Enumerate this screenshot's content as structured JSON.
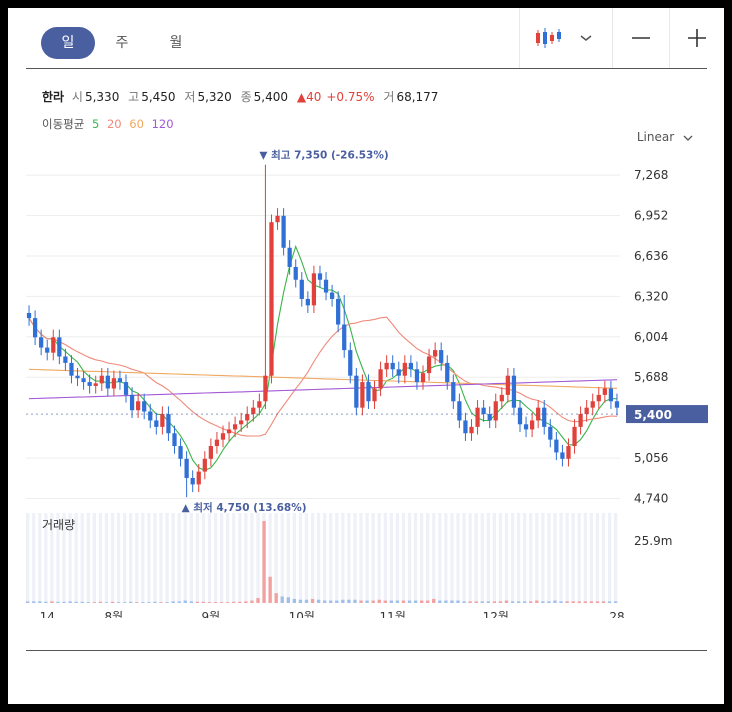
{
  "tabs": [
    {
      "label": "일",
      "active": true
    },
    {
      "label": "주",
      "active": false
    },
    {
      "label": "월",
      "active": false
    }
  ],
  "toolbar": {
    "chart_type_icon": "candlestick-icon",
    "dropdown_icon": "chevron-down-icon",
    "zoom_out_icon": "minus-icon",
    "zoom_in_icon": "plus-icon"
  },
  "stock": {
    "name": "한라",
    "open_label": "시",
    "open": "5,330",
    "high_label": "고",
    "high": "5,450",
    "low_label": "저",
    "low": "5,320",
    "close_label": "종",
    "close": "5,400",
    "change_arrow": "▲",
    "change": "40",
    "change_pct": "+0.75%",
    "volume_label": "거",
    "volume": "68,177"
  },
  "moving_average": {
    "label": "이동평균",
    "periods": [
      {
        "label": "5",
        "color": "#3bb54a"
      },
      {
        "label": "20",
        "color": "#f08a7a"
      },
      {
        "label": "60",
        "color": "#f0a860"
      },
      {
        "label": "120",
        "color": "#a35ad6"
      }
    ]
  },
  "scale_label": "Linear",
  "colors": {
    "up": "#e0413b",
    "down": "#2f6fd6",
    "accent": "#4a5fa0",
    "price_tag": "#4a5fa0"
  },
  "chart_data": {
    "type": "candlestick",
    "y_ticks": [
      "7,268",
      "6,952",
      "6,636",
      "6,320",
      "6,004",
      "5,688",
      "5,056",
      "4,740"
    ],
    "y_tick_values": [
      7268,
      6952,
      6636,
      6320,
      6004,
      5688,
      5056,
      4740
    ],
    "ylim": [
      4650,
      7480
    ],
    "x_ticks": [
      "14",
      "8월",
      "9월",
      "10월",
      "11월",
      "12월",
      "28"
    ],
    "x_tick_positions": [
      3,
      14,
      30,
      45,
      60,
      77,
      97
    ],
    "n": 98,
    "current_price": "5,400",
    "high_annotation": "▼ 최고 7,350 (-26.53%)",
    "low_annotation": "▲ 최저 4,750 (13.68%)",
    "high_index": 39,
    "low_index": 26,
    "high_value": 7350,
    "low_value": 4750,
    "volume_label": "거래량",
    "volume_tick": "25.9m",
    "volume_max": 25900000,
    "closes": [
      6150,
      6000,
      5920,
      5880,
      6000,
      5850,
      5800,
      5700,
      5680,
      5650,
      5620,
      5640,
      5700,
      5600,
      5680,
      5650,
      5550,
      5430,
      5500,
      5420,
      5350,
      5300,
      5400,
      5250,
      5150,
      5050,
      4900,
      4850,
      4950,
      5050,
      5150,
      5200,
      5250,
      5280,
      5320,
      5350,
      5400,
      5450,
      5500,
      5700,
      6900,
      6950,
      6700,
      6550,
      6450,
      6300,
      6250,
      6500,
      6450,
      6350,
      6300,
      6100,
      5900,
      5700,
      5450,
      5650,
      5500,
      5600,
      5750,
      5800,
      5750,
      5700,
      5800,
      5750,
      5650,
      5720,
      5850,
      5900,
      5800,
      5650,
      5500,
      5350,
      5250,
      5300,
      5450,
      5400,
      5350,
      5500,
      5550,
      5700,
      5450,
      5320,
      5280,
      5350,
      5450,
      5300,
      5200,
      5100,
      5050,
      5150,
      5300,
      5400,
      5450,
      5500,
      5550,
      5600,
      5500,
      5450,
      5400
    ],
    "volumes": [
      0.02,
      0.02,
      0.02,
      0.015,
      0.02,
      0.015,
      0.015,
      0.02,
      0.015,
      0.015,
      0.01,
      0.01,
      0.015,
      0.01,
      0.015,
      0.01,
      0.01,
      0.015,
      0.01,
      0.01,
      0.01,
      0.015,
      0.01,
      0.01,
      0.02,
      0.02,
      0.03,
      0.02,
      0.015,
      0.015,
      0.01,
      0.01,
      0.01,
      0.01,
      0.015,
      0.015,
      0.02,
      0.03,
      0.06,
      1.0,
      0.32,
      0.12,
      0.08,
      0.07,
      0.05,
      0.04,
      0.04,
      0.05,
      0.04,
      0.03,
      0.03,
      0.03,
      0.04,
      0.04,
      0.04,
      0.03,
      0.03,
      0.03,
      0.04,
      0.03,
      0.03,
      0.03,
      0.03,
      0.03,
      0.03,
      0.03,
      0.03,
      0.05,
      0.03,
      0.03,
      0.03,
      0.03,
      0.02,
      0.02,
      0.02,
      0.02,
      0.02,
      0.02,
      0.02,
      0.03,
      0.02,
      0.02,
      0.02,
      0.02,
      0.03,
      0.02,
      0.02,
      0.03,
      0.02,
      0.02,
      0.02,
      0.02,
      0.02,
      0.02,
      0.02,
      0.02,
      0.02,
      0.02
    ]
  }
}
